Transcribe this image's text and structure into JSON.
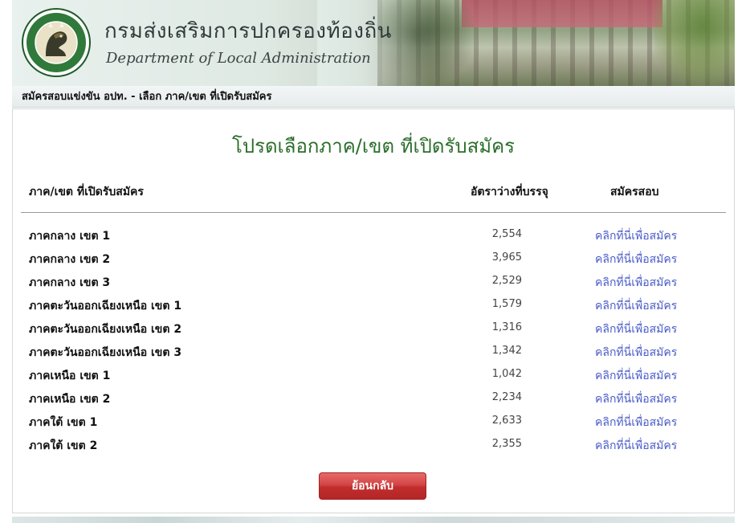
{
  "header": {
    "title_th": "กรมส่งเสริมการปกครองท้องถิ่น",
    "title_en": "Department of Local Administration",
    "logo_icon": "department-seal-icon"
  },
  "breadcrumb": {
    "text": "สมัครสอบแข่งขัน อปท. - เลือก ภาค/เขต ที่เปิดรับสมัคร"
  },
  "main": {
    "heading": "โปรดเลือกภาค/เขต ที่เปิดรับสมัคร",
    "columns": {
      "region": "ภาค/เขต ที่เปิดรับสมัคร",
      "vacancy": "อัตราว่างที่บรรจุ",
      "apply": "สมัครสอบ"
    },
    "rows": [
      {
        "region": "ภาคกลาง เขต 1",
        "vacancy": "2,554",
        "link": "คลิกที่นี่เพื่อสมัคร"
      },
      {
        "region": "ภาคกลาง เขต 2",
        "vacancy": "3,965",
        "link": "คลิกที่นี่เพื่อสมัคร"
      },
      {
        "region": "ภาคกลาง เขต 3",
        "vacancy": "2,529",
        "link": "คลิกที่นี่เพื่อสมัคร"
      },
      {
        "region": "ภาคตะวันออกเฉียงเหนือ เขต 1",
        "vacancy": "1,579",
        "link": "คลิกที่นี่เพื่อสมัคร"
      },
      {
        "region": "ภาคตะวันออกเฉียงเหนือ เขต 2",
        "vacancy": "1,316",
        "link": "คลิกที่นี่เพื่อสมัคร"
      },
      {
        "region": "ภาคตะวันออกเฉียงเหนือ เขต 3",
        "vacancy": "1,342",
        "link": "คลิกที่นี่เพื่อสมัคร"
      },
      {
        "region": "ภาคเหนือ เขต 1",
        "vacancy": "1,042",
        "link": "คลิกที่นี่เพื่อสมัคร"
      },
      {
        "region": "ภาคเหนือ เขต 2",
        "vacancy": "2,234",
        "link": "คลิกที่นี่เพื่อสมัคร"
      },
      {
        "region": "ภาคใต้ เขต 1",
        "vacancy": "2,633",
        "link": "คลิกที่นี่เพื่อสมัคร"
      },
      {
        "region": "ภาคใต้ เขต 2",
        "vacancy": "2,355",
        "link": "คลิกที่นี่เพื่อสมัคร"
      }
    ],
    "back_button": "ย้อนกลับ"
  },
  "colors": {
    "heading_green": "#2b6e2b",
    "link_blue": "#4a5cc8",
    "button_red": "#c12d2d"
  }
}
